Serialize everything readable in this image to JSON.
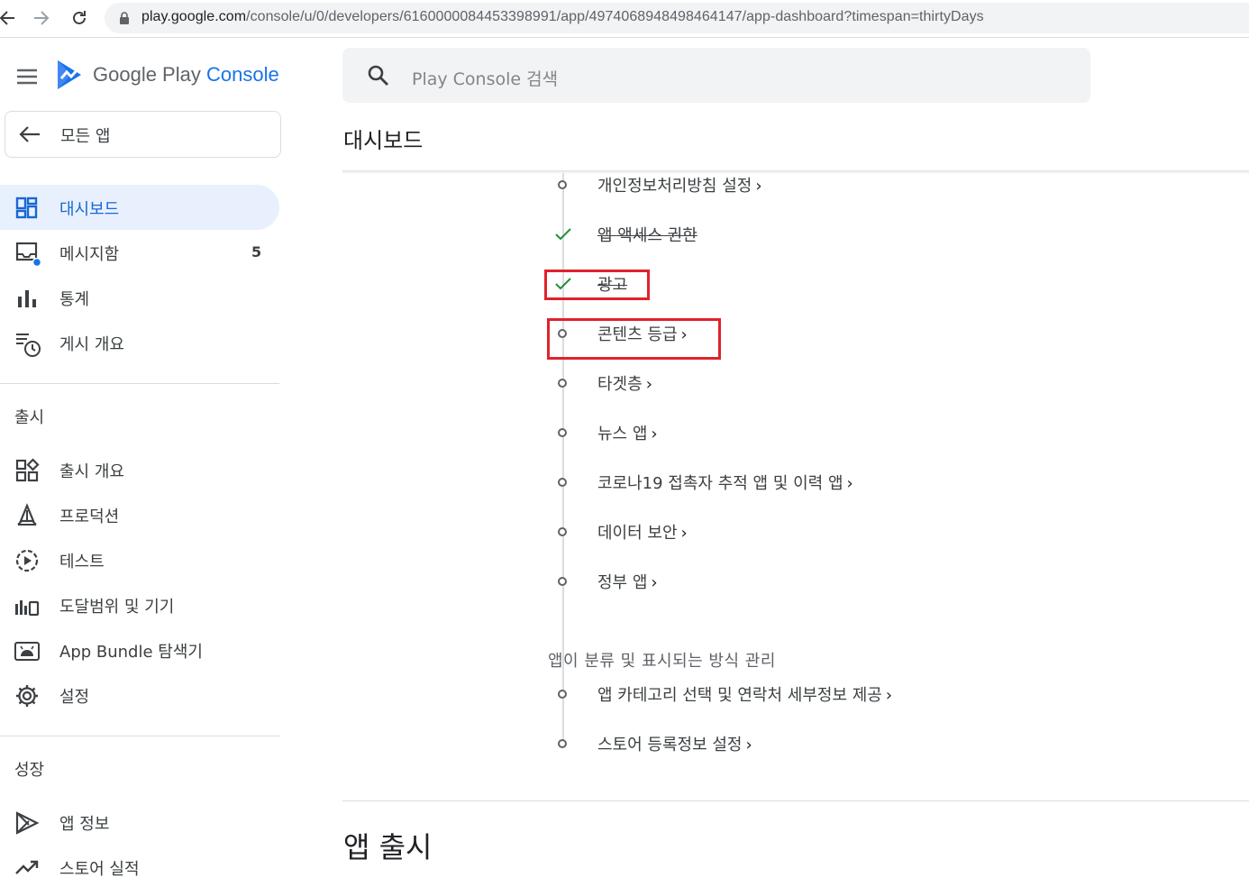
{
  "browser": {
    "url_host": "play.google.com",
    "url_path": "/console/u/0/developers/6160000084453398991/app/4974068948498464147/app-dashboard?timespan=thirtyDays"
  },
  "sidebar": {
    "brand_google": "Google Play",
    "brand_console": "Console",
    "all_apps_label": "모든 앱",
    "top_items": [
      {
        "label": "대시보드",
        "icon": "dashboard-icon",
        "active": true
      },
      {
        "label": "메시지함",
        "icon": "inbox-icon",
        "count": "5"
      },
      {
        "label": "통계",
        "icon": "bar-chart-icon"
      },
      {
        "label": "게시 개요",
        "icon": "publishing-overview-icon"
      }
    ],
    "release_section": "출시",
    "release_items": [
      {
        "label": "출시 개요",
        "icon": "release-overview-icon"
      },
      {
        "label": "프로덕션",
        "icon": "production-icon"
      },
      {
        "label": "테스트",
        "icon": "testing-icon"
      },
      {
        "label": "도달범위 및 기기",
        "icon": "reach-devices-icon"
      },
      {
        "label": "App Bundle 탐색기",
        "icon": "android-icon"
      },
      {
        "label": "설정",
        "icon": "gear-icon"
      }
    ],
    "growth_section": "성장",
    "growth_items": [
      {
        "label": "앱 정보",
        "icon": "play-icon"
      },
      {
        "label": "스토어 실적",
        "icon": "trending-up-icon"
      }
    ]
  },
  "main": {
    "search_placeholder": "Play Console 검색",
    "title": "대시보드",
    "tasks": [
      {
        "label": "개인정보처리방침 설정",
        "done": false,
        "chevron": "›"
      },
      {
        "label": "앱 액세스 권한",
        "done": true,
        "chevron": ""
      },
      {
        "label": "광고",
        "done": true,
        "chevron": ""
      },
      {
        "label": "콘텐츠 등급",
        "done": false,
        "chevron": "›"
      },
      {
        "label": "타겟층",
        "done": false,
        "chevron": "›"
      },
      {
        "label": "뉴스 앱",
        "done": false,
        "chevron": "›"
      },
      {
        "label": "코로나19 접촉자 추적 앱 및 이력 앱",
        "done": false,
        "chevron": "›"
      },
      {
        "label": "데이터 보안",
        "done": false,
        "chevron": "›"
      },
      {
        "label": "정부 앱",
        "done": false,
        "chevron": "›"
      }
    ],
    "subheading": "앱이 분류 및 표시되는 방식 관리",
    "sub_tasks": [
      {
        "label": "앱 카테고리 선택 및 연락처 세부정보 제공",
        "done": false,
        "chevron": "›"
      },
      {
        "label": "스토어 등록정보 설정",
        "done": false,
        "chevron": "›"
      }
    ],
    "section_heading": "앱 출시"
  },
  "colors": {
    "accent": "#1a73e8",
    "active_bg": "#e8f0fe",
    "check": "#1e8e3e",
    "highlight": "#e0222c"
  }
}
